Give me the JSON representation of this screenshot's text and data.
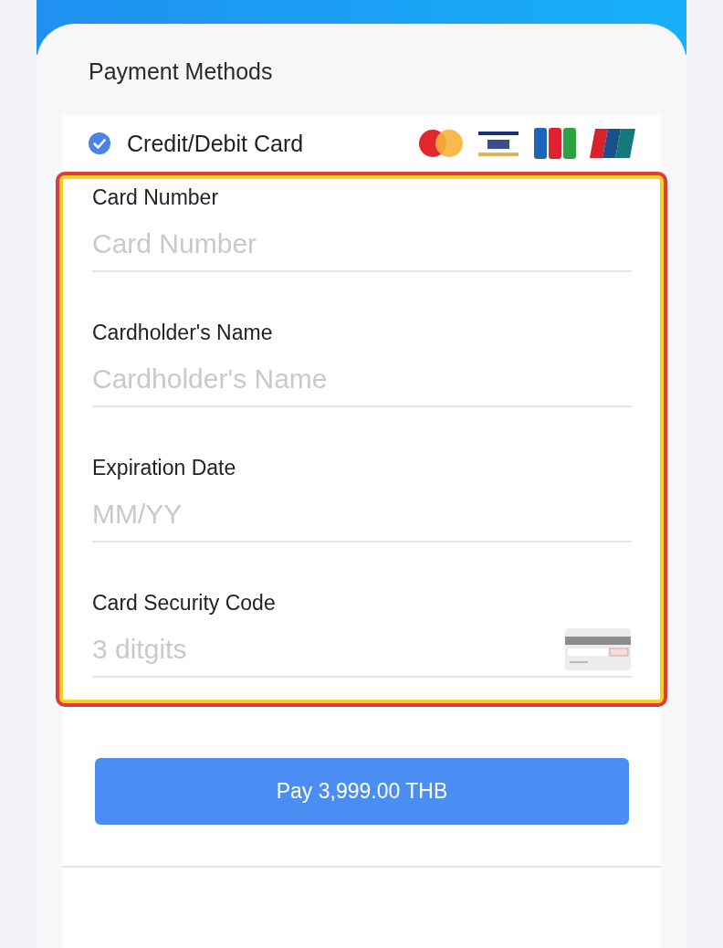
{
  "header": {
    "title": "Payment Methods"
  },
  "method": {
    "label": "Credit/Debit Card",
    "selected": true
  },
  "fields": [
    {
      "kind": "text",
      "label": "Card Number",
      "placeholder": "Card Number"
    },
    {
      "kind": "text",
      "label": "Cardholder's Name",
      "placeholder": "Cardholder's Name"
    },
    {
      "kind": "text",
      "label": "Expiration Date",
      "placeholder": "MM/YY"
    },
    {
      "kind": "cvv",
      "label": "Card Security Code",
      "placeholder": "3 ditgits"
    }
  ],
  "pay_button": {
    "label": "Pay 3,999.00 THB"
  }
}
